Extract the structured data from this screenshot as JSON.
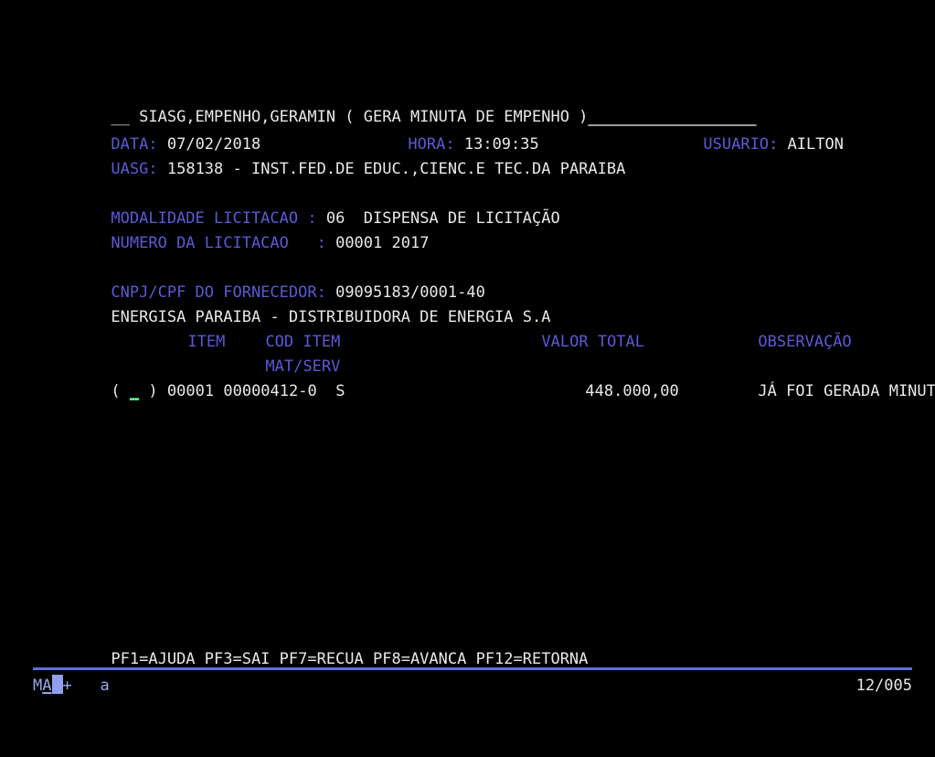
{
  "terminal": {
    "screen_title_line": "__ SIASG,EMPENHO,GERAMIN ( GERA MINUTA DE EMPENHO )",
    "title_fill": "__________________",
    "colors": {
      "background": "#000000",
      "label_blue": "#5a5ad6",
      "value_white": "#e8e8e8",
      "cursor_green": "#13c24a",
      "status_blue": "#5a6fd6",
      "caret_blue": "#8fa0ee"
    }
  },
  "header": {
    "data_label": "DATA:",
    "data_value": "07/02/2018",
    "hora_label": "HORA:",
    "hora_value": "13:09:35",
    "usuario_label": "USUARIO:",
    "usuario_value": "AILTON",
    "uasg_label": "UASG:",
    "uasg_value": "158138 - INST.FED.DE EDUC.,CIENC.E TEC.DA PARAIBA"
  },
  "licitacao": {
    "modalidade_label": "MODALIDADE LICITACAO :",
    "modalidade_value": "06  DISPENSA DE LICITAÇÃO",
    "numero_label": "NUMERO DA LICITACAO   :",
    "numero_value": "00001 2017"
  },
  "fornecedor": {
    "cnpj_label": "CNPJ/CPF DO FORNECEDOR:",
    "cnpj_value": "09095183/0001-40",
    "nome": "ENERGISA PARAIBA - DISTRIBUIDORA DE ENERGIA S.A"
  },
  "table": {
    "headers": {
      "item": "ITEM",
      "cod_item": "COD ITEM",
      "cod_item_sub": "MAT/SERV",
      "valor_total": "VALOR TOTAL",
      "observacao": "OBSERVAÇÃO"
    },
    "rows": [
      {
        "select_open": "(",
        "select_cursor": "_",
        "select_close": ")",
        "item": "00001",
        "cod_item": "00000412-0",
        "mat_serv": "S",
        "valor_total": "448.000,00",
        "observacao": "JÁ FOI GERADA MINUTA"
      }
    ]
  },
  "function_keys": {
    "line": "PF1=AJUDA PF3=SAI PF7=RECUA PF8=AVANCA PF12=RETORNA"
  },
  "status": {
    "connection_mode": "MA",
    "plus_indicator": "+",
    "keyboard_indicator": "a",
    "cursor_position": "12/005"
  }
}
